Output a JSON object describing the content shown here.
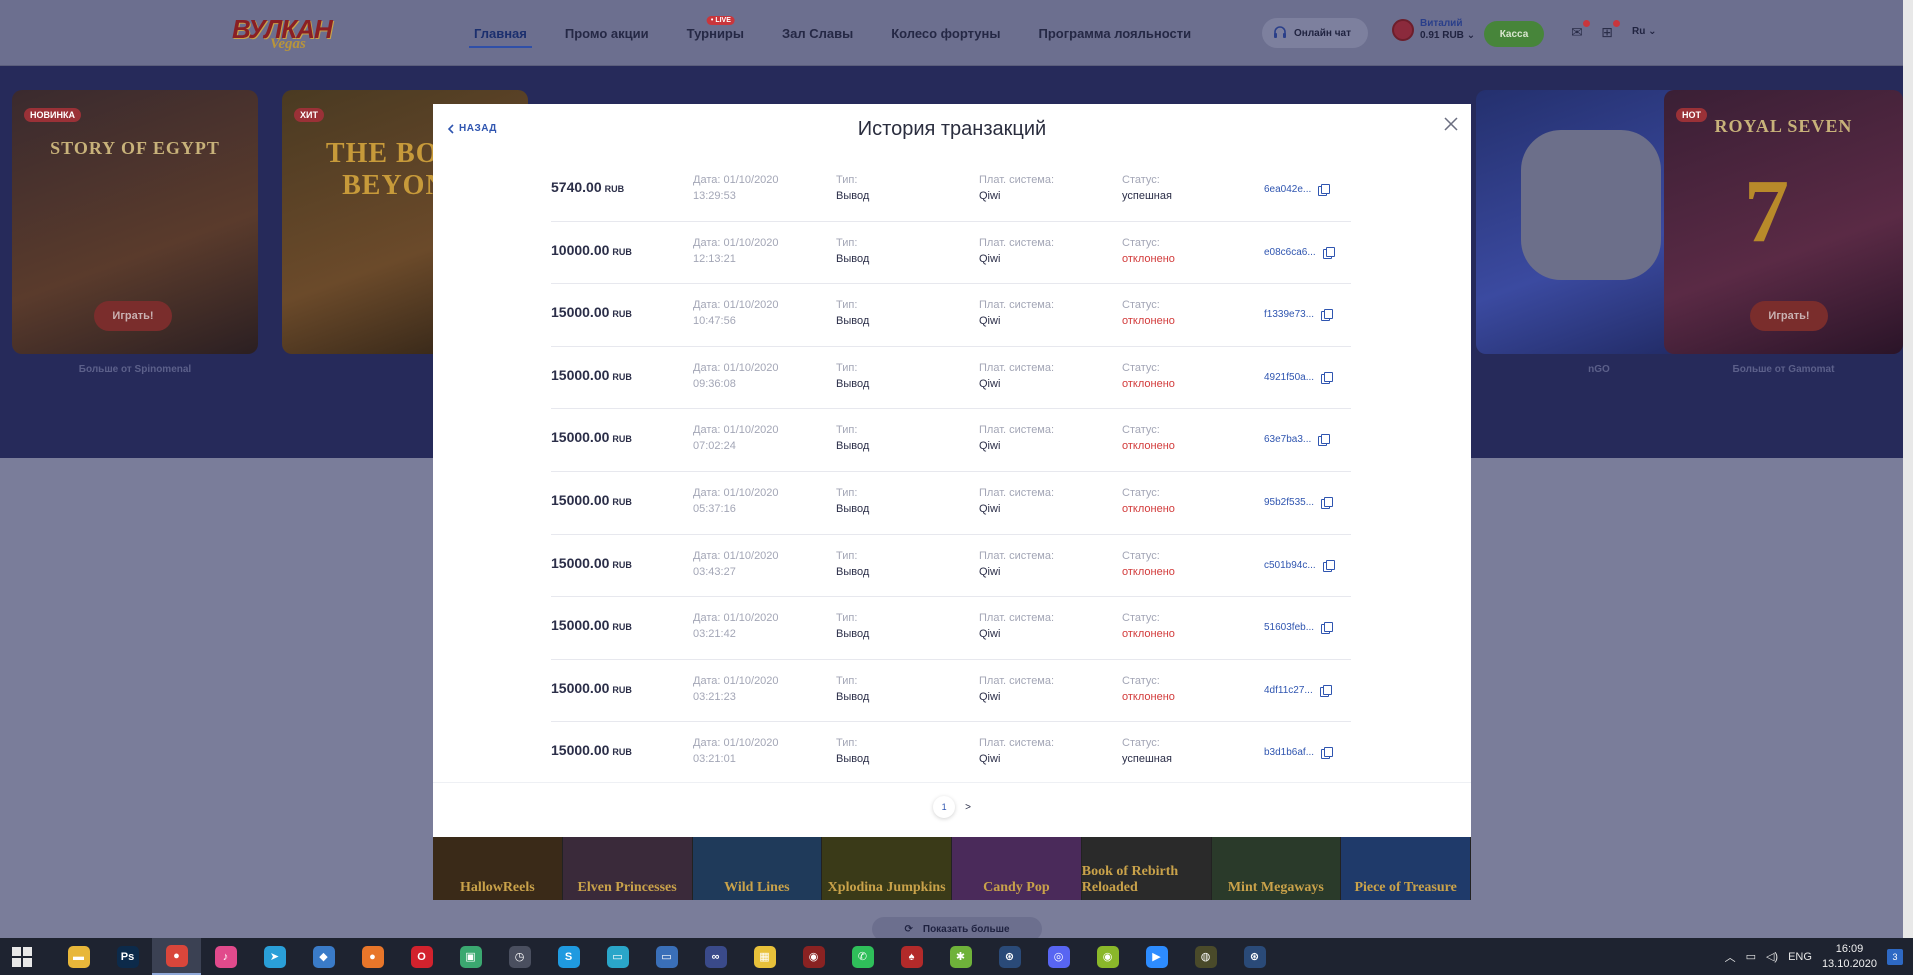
{
  "header": {
    "logo_main": "ВУЛКАН",
    "logo_sub": "Vegas",
    "nav": [
      {
        "label": "Главная"
      },
      {
        "label": "Промо акции"
      },
      {
        "label": "Турниры",
        "badge": "• LIVE"
      },
      {
        "label": "Зал Славы"
      },
      {
        "label": "Колесо фортуны"
      },
      {
        "label": "Программа лояльности"
      }
    ],
    "chat_label": "Онлайн чат",
    "user_name": "Виталий",
    "user_balance": "0.91 RUB",
    "cashier_label": "Касса",
    "lang": "Ru",
    "colors": {
      "cashier": "#47853a",
      "badge_red": "#c9363c"
    }
  },
  "games": [
    {
      "badge": "НОВИНКА",
      "title": "STORY OF EGYPT",
      "play": "Играть!",
      "provider": "Больше от Spinomenal"
    },
    {
      "badge": "ХИТ",
      "title": "THE BOOK BEYOND",
      "play": "",
      "provider": ""
    },
    {
      "badge": "",
      "title": "",
      "play": "",
      "provider": ""
    },
    {
      "badge": "",
      "title": "",
      "play": "",
      "provider": ""
    },
    {
      "badge": "",
      "title": "",
      "play": "",
      "provider": "nGO"
    },
    {
      "badge": "HOT",
      "title": "ROYAL SEVEN",
      "play": "Играть!",
      "provider": "Больше от Gamomat"
    }
  ],
  "thumbs": [
    "HallowReels",
    "Elven Princesses",
    "Wild Lines",
    "Xplodina Jumpkins",
    "Candy Pop",
    "Book of Rebirth Reloaded",
    "Mint Megaways",
    "Piece of Treasure"
  ],
  "show_more": "Показать больше",
  "modal": {
    "title": "История транзакций",
    "back_label": "НАЗАД",
    "labels": {
      "date": "Дата:",
      "type": "Тип:",
      "system": "Плат. система:",
      "status": "Статус:"
    },
    "transactions": [
      {
        "amount": "5740.00",
        "currency": "RUB",
        "date": "01/10/2020",
        "time": "13:29:53",
        "type": "Вывод",
        "system": "Qiwi",
        "status": "успешная",
        "status_kind": "ok",
        "id": "6ea042e..."
      },
      {
        "amount": "10000.00",
        "currency": "RUB",
        "date": "01/10/2020",
        "time": "12:13:21",
        "type": "Вывод",
        "system": "Qiwi",
        "status": "отклонено",
        "status_kind": "rej",
        "id": "e08c6ca6..."
      },
      {
        "amount": "15000.00",
        "currency": "RUB",
        "date": "01/10/2020",
        "time": "10:47:56",
        "type": "Вывод",
        "system": "Qiwi",
        "status": "отклонено",
        "status_kind": "rej",
        "id": "f1339e73..."
      },
      {
        "amount": "15000.00",
        "currency": "RUB",
        "date": "01/10/2020",
        "time": "09:36:08",
        "type": "Вывод",
        "system": "Qiwi",
        "status": "отклонено",
        "status_kind": "rej",
        "id": "4921f50a..."
      },
      {
        "amount": "15000.00",
        "currency": "RUB",
        "date": "01/10/2020",
        "time": "07:02:24",
        "type": "Вывод",
        "system": "Qiwi",
        "status": "отклонено",
        "status_kind": "rej",
        "id": "63e7ba3..."
      },
      {
        "amount": "15000.00",
        "currency": "RUB",
        "date": "01/10/2020",
        "time": "05:37:16",
        "type": "Вывод",
        "system": "Qiwi",
        "status": "отклонено",
        "status_kind": "rej",
        "id": "95b2f535..."
      },
      {
        "amount": "15000.00",
        "currency": "RUB",
        "date": "01/10/2020",
        "time": "03:43:27",
        "type": "Вывод",
        "system": "Qiwi",
        "status": "отклонено",
        "status_kind": "rej",
        "id": "c501b94c..."
      },
      {
        "amount": "15000.00",
        "currency": "RUB",
        "date": "01/10/2020",
        "time": "03:21:42",
        "type": "Вывод",
        "system": "Qiwi",
        "status": "отклонено",
        "status_kind": "rej",
        "id": "51603feb..."
      },
      {
        "amount": "15000.00",
        "currency": "RUB",
        "date": "01/10/2020",
        "time": "03:21:23",
        "type": "Вывод",
        "system": "Qiwi",
        "status": "отклонено",
        "status_kind": "rej",
        "id": "4df11c27..."
      },
      {
        "amount": "15000.00",
        "currency": "RUB",
        "date": "01/10/2020",
        "time": "03:21:01",
        "type": "Вывод",
        "system": "Qiwi",
        "status": "успешная",
        "status_kind": "ok",
        "id": "b3d1b6af..."
      }
    ],
    "pager": {
      "current": "1",
      "next": ">"
    },
    "colors": {
      "rejected": "#d23b3b",
      "link": "#2f55b0"
    }
  },
  "taskbar": {
    "apps": [
      {
        "name": "file-explorer-icon",
        "glyph": "▬",
        "color": "#e8b73a"
      },
      {
        "name": "photoshop-icon",
        "glyph": "Ps",
        "color": "#0c2a4a"
      },
      {
        "name": "chrome-icon",
        "glyph": "●",
        "color": "#d9463b"
      },
      {
        "name": "itunes-icon",
        "glyph": "♪",
        "color": "#e14a8c"
      },
      {
        "name": "telegram-icon",
        "glyph": "➤",
        "color": "#2a9fd8"
      },
      {
        "name": "app-icon",
        "glyph": "◆",
        "color": "#3a7bc8"
      },
      {
        "name": "firefox-icon",
        "glyph": "●",
        "color": "#e8762a"
      },
      {
        "name": "opera-icon",
        "glyph": "O",
        "color": "#d2222d"
      },
      {
        "name": "game-icon",
        "glyph": "▣",
        "color": "#3ba870"
      },
      {
        "name": "clock-app-icon",
        "glyph": "◷",
        "color": "#4a4f5f"
      },
      {
        "name": "skype-icon",
        "glyph": "S",
        "color": "#1f9ae0"
      },
      {
        "name": "monitor-app-icon",
        "glyph": "▭",
        "color": "#2aa6c9"
      },
      {
        "name": "desktop-icon",
        "glyph": "▭",
        "color": "#3a6fb8"
      },
      {
        "name": "link-icon",
        "glyph": "∞",
        "color": "#3a4a8a"
      },
      {
        "name": "image-app-icon",
        "glyph": "▦",
        "color": "#e8c13a"
      },
      {
        "name": "record-icon",
        "glyph": "◉",
        "color": "#8a2222"
      },
      {
        "name": "whatsapp-icon",
        "glyph": "✆",
        "color": "#2fbf5a"
      },
      {
        "name": "poker-icon",
        "glyph": "♠",
        "color": "#b32a2a"
      },
      {
        "name": "settings-app-icon",
        "glyph": "✱",
        "color": "#6fb23a"
      },
      {
        "name": "steam-icon",
        "glyph": "⊛",
        "color": "#2a4a78"
      },
      {
        "name": "discord-icon",
        "glyph": "◎",
        "color": "#5865f2"
      },
      {
        "name": "media-icon",
        "glyph": "◉",
        "color": "#8ab82a"
      },
      {
        "name": "zoom-icon",
        "glyph": "▶",
        "color": "#2d8cff"
      },
      {
        "name": "browser-icon",
        "glyph": "◍",
        "color": "#4a4a2a"
      },
      {
        "name": "steam-2-icon",
        "glyph": "⊛",
        "color": "#2a4a78"
      }
    ],
    "lang": "ENG",
    "time": "16:09",
    "date": "13.10.2020",
    "notif_count": "3"
  }
}
